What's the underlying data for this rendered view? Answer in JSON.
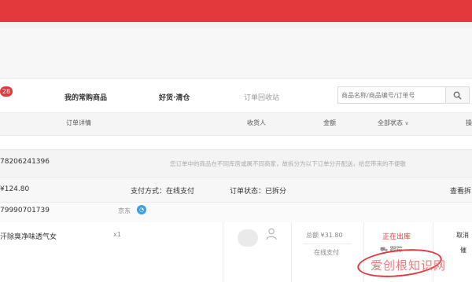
{
  "tabs": {
    "badge_count": "28",
    "items": [
      "我的常购商品",
      "好货·清仓",
      "订单回收站"
    ]
  },
  "search": {
    "placeholder": "商品名称/商品编号/订单号",
    "button_icon": "search-icon"
  },
  "table_header": {
    "columns": [
      "订单详情",
      "收货人",
      "金额",
      "全部状态",
      "操"
    ],
    "status_filter_arrow": "chevron-down-icon"
  },
  "order": {
    "order_number": "78206241396",
    "notice": "您订单中的商品在不同库房或属不同商家，故拆分为以下订单分开配送，给您带来的不便敬",
    "total": "¥124.80",
    "payment": "支付方式：在线支付",
    "status": "订单状态：已拆分",
    "view": "查看拆",
    "sub_order_number": "79990701739",
    "shop": "京东",
    "item": {
      "name": "汗除臭净味透气女",
      "qty": "x1",
      "total_label": "总额 ¥31.80",
      "pay_method": "在线支付",
      "status": "正在出库",
      "track": "跟踪",
      "action_cancel": "取消",
      "action_more": "催"
    }
  },
  "watermark": "爱创根知识网",
  "colors": {
    "brand_red": "#e4393c"
  }
}
